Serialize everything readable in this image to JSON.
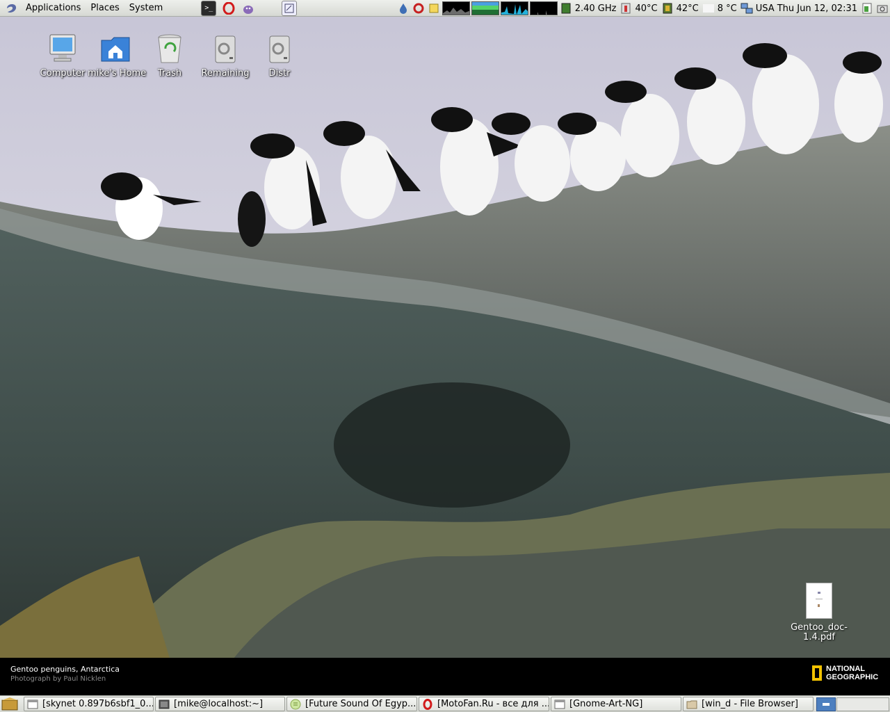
{
  "top_panel": {
    "menus": [
      "Applications",
      "Places",
      "System"
    ],
    "cpu_freq": "2.40 GHz",
    "temp1": "40°C",
    "temp2": "42°C",
    "weather": "8 °C",
    "clock": "USA Thu Jun 12, 02:31"
  },
  "desktop": {
    "icons": [
      "Computer",
      "mike's Home",
      "Trash",
      "Remaining",
      "Distr"
    ],
    "file": "Gentoo_doc-1.4.pdf"
  },
  "wallpaper": {
    "caption": "Gentoo penguins, Antarctica",
    "credit": "Photograph by Paul Nicklen",
    "brand": [
      "NATIONAL",
      "GEOGRAPHIC"
    ],
    "brand_color": "#f2c200"
  },
  "taskbar": {
    "tasks": [
      "[skynet 0.897b6sbf1_0...",
      "[mike@localhost:~]",
      "[Future Sound Of Egyp...",
      "[MotoFan.Ru - все для ...",
      "[Gnome-Art-NG]",
      "[win_d - File Browser]"
    ]
  }
}
